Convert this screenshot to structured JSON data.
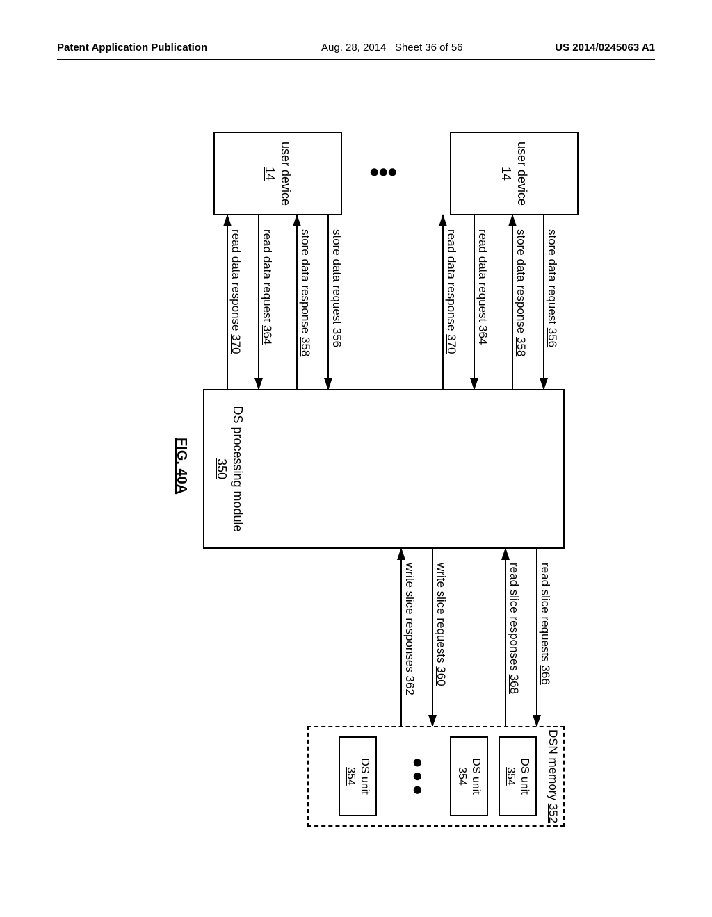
{
  "header": {
    "publication": "Patent Application Publication",
    "date": "Aug. 28, 2014",
    "sheet": "Sheet 36 of 56",
    "docnum": "US 2014/0245063 A1"
  },
  "figure_label": "FIG. 40A",
  "blocks": {
    "user_device": {
      "label": "user device",
      "ref": "14"
    },
    "ds_processing": {
      "label": "DS processing module",
      "ref": "350"
    },
    "dsn_memory": {
      "label": "DSN memory",
      "ref": "352"
    },
    "ds_unit": {
      "label": "DS unit",
      "ref": "354"
    }
  },
  "arrows_left": [
    {
      "text": "store data request",
      "ref": "356"
    },
    {
      "text": "store data response",
      "ref": "358"
    },
    {
      "text": "read data request",
      "ref": "364"
    },
    {
      "text": "read data response",
      "ref": "370"
    }
  ],
  "arrows_right": [
    {
      "text": "read slice requests",
      "ref": "366"
    },
    {
      "text": "read slice responses",
      "ref": "368"
    },
    {
      "text": "write slice requests",
      "ref": "360"
    },
    {
      "text": "write slice responses",
      "ref": "362"
    }
  ]
}
